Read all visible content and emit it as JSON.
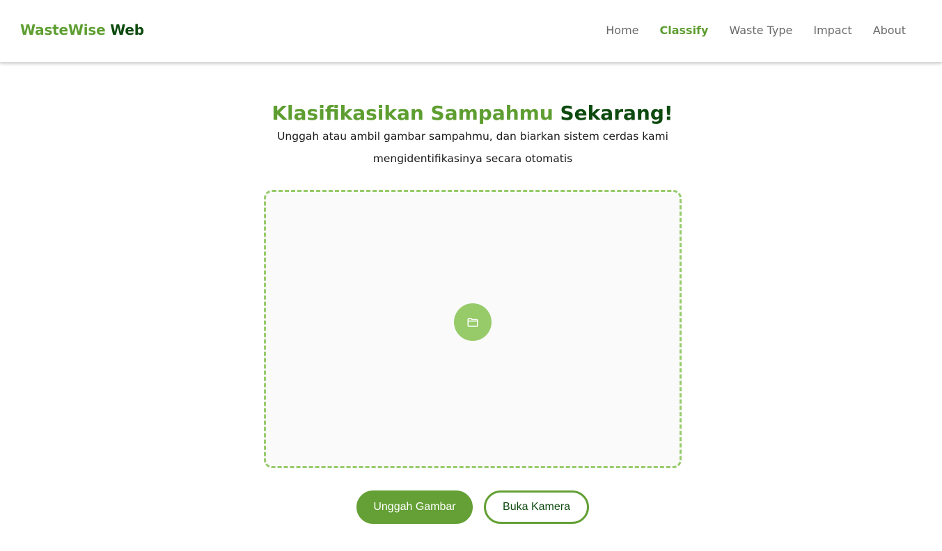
{
  "navbar": {
    "brand_part1": "WasteWise",
    "brand_part2": "Web",
    "links": [
      {
        "label": "Home"
      },
      {
        "label": "Classify"
      },
      {
        "label": "Waste Type"
      },
      {
        "label": "Impact"
      },
      {
        "label": "About"
      }
    ],
    "active": "Classify"
  },
  "hero": {
    "title_part1": "Klasifikasikan Sampahmu",
    "title_part2": "Sekarang!",
    "subtitle": "Unggah atau ambil gambar sampahmu, dan biarkan sistem cerdas kami mengidentifikasinya secara otomatis"
  },
  "dropzone": {
    "icon": "folder-icon"
  },
  "actions": {
    "upload_label": "Unggah Gambar",
    "camera_label": "Buka Kamera"
  },
  "colors": {
    "brand_green": "#5e9e31",
    "dark_green": "#0d4a0f",
    "light_green": "#97cb6a",
    "button_green": "#64a035"
  }
}
